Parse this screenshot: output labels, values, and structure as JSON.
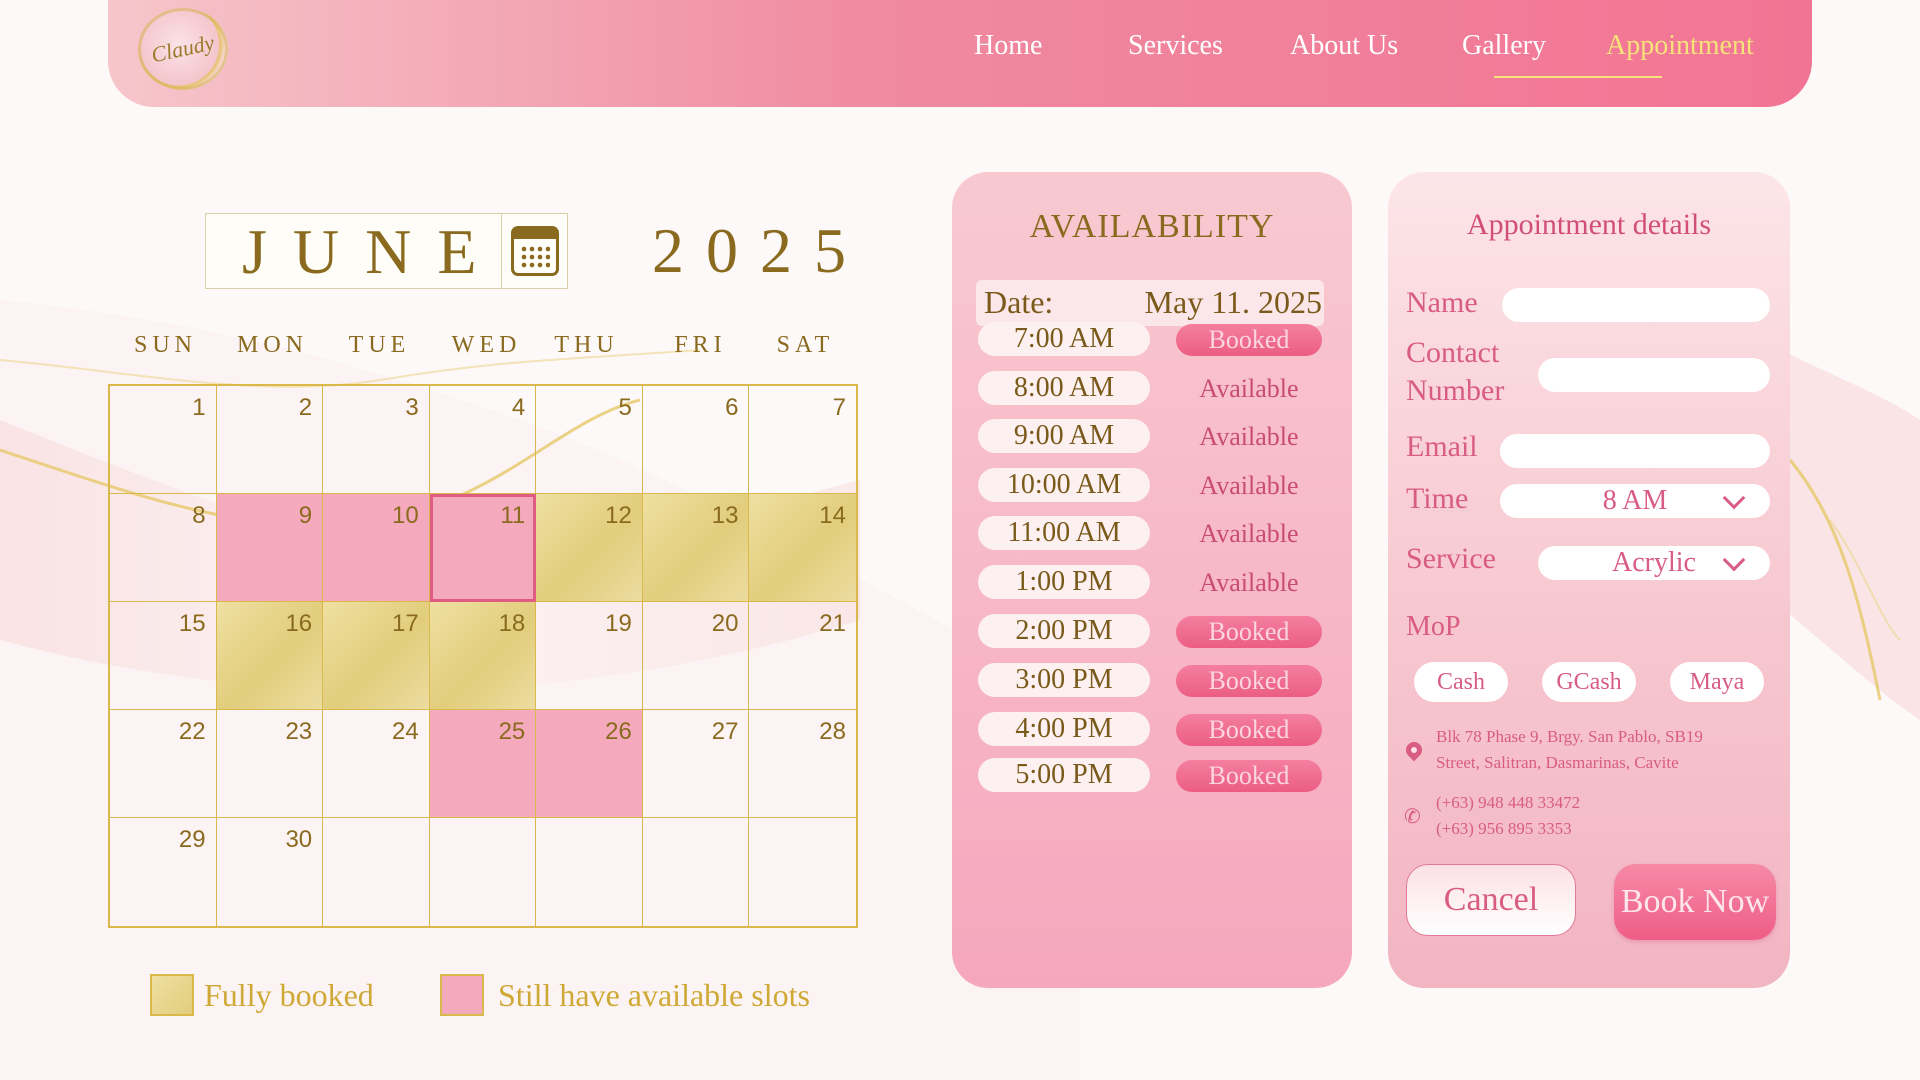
{
  "nav": {
    "logo_text": "Claudy",
    "items": [
      {
        "label": "Home",
        "active": false
      },
      {
        "label": "Services",
        "active": false
      },
      {
        "label": "About Us",
        "active": false
      },
      {
        "label": "Gallery",
        "active": false
      },
      {
        "label": "Appointment",
        "active": true
      }
    ]
  },
  "calendar": {
    "month": "JUNE",
    "year": "2025",
    "weekdays": [
      "SUN",
      "MON",
      "TUE",
      "WED",
      "THU",
      "FRI",
      "SAT"
    ],
    "days": [
      {
        "n": "1",
        "state": "none"
      },
      {
        "n": "2",
        "state": "none"
      },
      {
        "n": "3",
        "state": "none"
      },
      {
        "n": "4",
        "state": "none"
      },
      {
        "n": "5",
        "state": "none"
      },
      {
        "n": "6",
        "state": "none"
      },
      {
        "n": "7",
        "state": "none"
      },
      {
        "n": "8",
        "state": "none"
      },
      {
        "n": "9",
        "state": "slots"
      },
      {
        "n": "10",
        "state": "slots"
      },
      {
        "n": "11",
        "state": "slots",
        "selected": true
      },
      {
        "n": "12",
        "state": "full"
      },
      {
        "n": "13",
        "state": "full"
      },
      {
        "n": "14",
        "state": "full"
      },
      {
        "n": "15",
        "state": "none"
      },
      {
        "n": "16",
        "state": "full"
      },
      {
        "n": "17",
        "state": "full"
      },
      {
        "n": "18",
        "state": "full"
      },
      {
        "n": "19",
        "state": "none"
      },
      {
        "n": "20",
        "state": "none"
      },
      {
        "n": "21",
        "state": "none"
      },
      {
        "n": "22",
        "state": "none"
      },
      {
        "n": "23",
        "state": "none"
      },
      {
        "n": "24",
        "state": "none"
      },
      {
        "n": "25",
        "state": "slots"
      },
      {
        "n": "26",
        "state": "slots"
      },
      {
        "n": "27",
        "state": "none"
      },
      {
        "n": "28",
        "state": "none"
      },
      {
        "n": "29",
        "state": "none"
      },
      {
        "n": "30",
        "state": "none"
      },
      {
        "n": "",
        "state": "none"
      },
      {
        "n": "",
        "state": "none"
      },
      {
        "n": "",
        "state": "none"
      },
      {
        "n": "",
        "state": "none"
      },
      {
        "n": "",
        "state": "none"
      }
    ],
    "legend": {
      "full_label": "Fully booked",
      "slots_label": "Still have available slots"
    }
  },
  "availability": {
    "title": "AVAILABILITY",
    "date_label": "Date:",
    "date_value": "May 11. 2025",
    "slots": [
      {
        "time": "7:00 AM",
        "status": "Booked"
      },
      {
        "time": "8:00 AM",
        "status": "Available"
      },
      {
        "time": "9:00 AM",
        "status": "Available"
      },
      {
        "time": "10:00 AM",
        "status": "Available"
      },
      {
        "time": "11:00 AM",
        "status": "Available"
      },
      {
        "time": "1:00 PM",
        "status": "Available"
      },
      {
        "time": "2:00 PM",
        "status": "Booked"
      },
      {
        "time": "3:00 PM",
        "status": "Booked"
      },
      {
        "time": "4:00 PM",
        "status": "Booked"
      },
      {
        "time": "5:00 PM",
        "status": "Booked"
      }
    ]
  },
  "details": {
    "title": "Appointment details",
    "name_label": "Name",
    "name_value": "",
    "contact_label_1": "Contact",
    "contact_label_2": "Number",
    "contact_value": "",
    "email_label": "Email",
    "email_value": "",
    "time_label": "Time",
    "time_value": "8 AM",
    "service_label": "Service",
    "service_value": "Acrylic",
    "mop_label": "MoP",
    "mop_options": [
      "Cash",
      "GCash",
      "Maya"
    ],
    "address_line1": "Blk 78 Phase 9, Brgy. San Pablo, SB19",
    "address_line2": "Street, Salitran, Dasmarinas, Cavite",
    "phone_1": "(+63) 948 448 33472",
    "phone_2": "(+63) 956 895 3353",
    "cancel_label": "Cancel",
    "book_label": "Book Now"
  }
}
